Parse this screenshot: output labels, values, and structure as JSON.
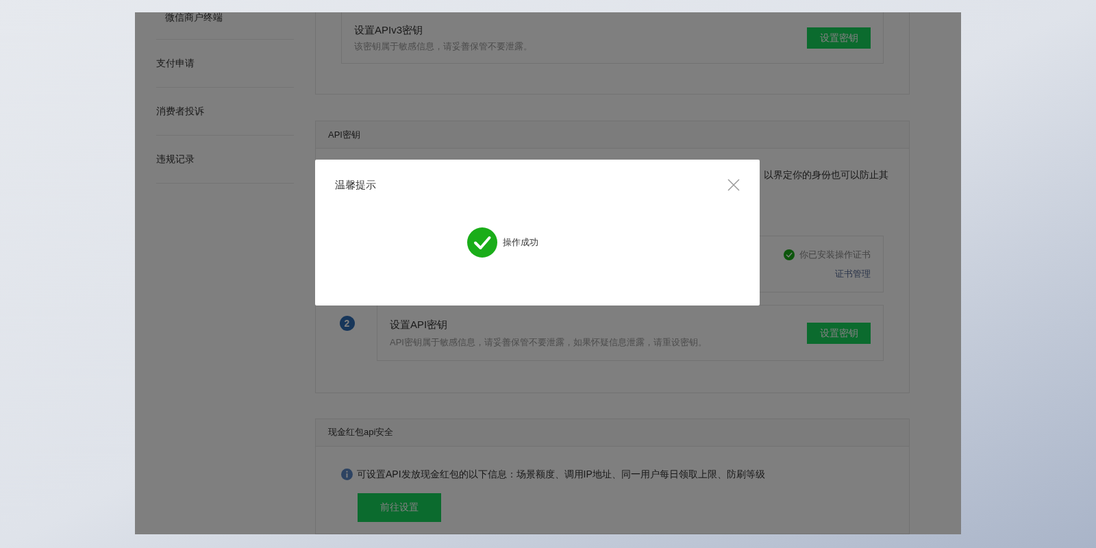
{
  "sidebar": {
    "items": [
      {
        "label": "微信商户终端",
        "kind": "subitem"
      },
      {
        "label": "支付申请",
        "kind": "item"
      },
      {
        "label": "消费者投诉",
        "kind": "item"
      },
      {
        "label": "违规记录",
        "kind": "item"
      }
    ]
  },
  "apiv3_card": {
    "title": "设置APIv3密钥",
    "description": "该密钥属于敏感信息，请妥善保管不要泄露。",
    "button": "设置密钥"
  },
  "api_key_section": {
    "header": "API密钥",
    "intro": "以界定你的身份也可以防止其",
    "steps": [
      {
        "kind": "certificate",
        "status": "你已安装操作证书",
        "link": "证书管理"
      },
      {
        "kind": "key",
        "number": "2",
        "title": "设置API密钥",
        "description": "API密钥属于敏感信息，请妥善保管不要泄露，如果怀疑信息泄露，请重设密钥。",
        "button": "设置密钥"
      }
    ]
  },
  "red_packet_section": {
    "header": "现金红包api安全",
    "info": "可设置API发放现金红包的以下信息：场景额度、调用IP地址、同一用户每日领取上限、防刷等级",
    "button": "前往设置"
  },
  "dialog": {
    "title": "温馨提示",
    "message": "操作成功"
  }
}
